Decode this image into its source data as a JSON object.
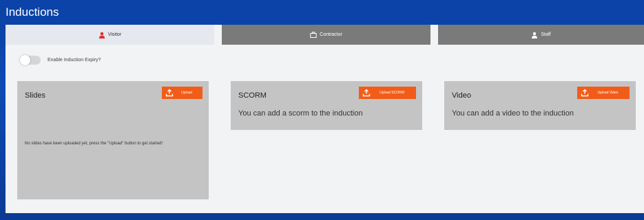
{
  "header": {
    "title": "Inductions"
  },
  "tabs": [
    {
      "label": "Visitor",
      "icon": "person-icon",
      "active": true
    },
    {
      "label": "Contractor",
      "icon": "briefcase-icon",
      "active": false
    },
    {
      "label": "Staff",
      "icon": "person-badge-icon",
      "active": false
    }
  ],
  "toggle": {
    "label": "Enable Induction Expiry?",
    "checked": false
  },
  "cards": {
    "slides": {
      "title": "Slides",
      "button": "Upload",
      "empty_message": "No slides have been uploaded yet, press the \"Upload\" button to get started!"
    },
    "scorm": {
      "title": "SCORM",
      "button": "Upload SCORM",
      "description": "You can add a scorm to the induction"
    },
    "video": {
      "title": "Video",
      "button": "Upload Video",
      "description": "You can add a video to the induction"
    }
  },
  "colors": {
    "header_blue": "#0b43a8",
    "accent_orange": "#f25c19",
    "tab_active": "#e5e8ee",
    "tab_inactive": "#7a7a7a",
    "card_bg": "#c4c4c4",
    "visitor_icon": "#e0312a"
  }
}
